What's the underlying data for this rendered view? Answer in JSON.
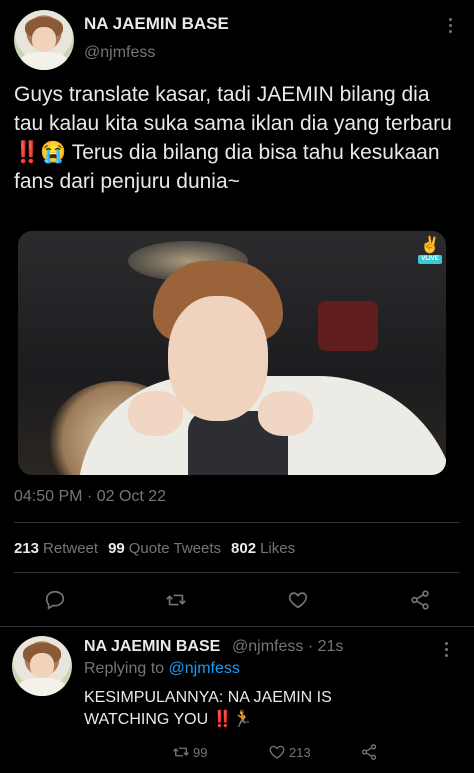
{
  "tweet": {
    "author_name": "NA JAEMIN BASE",
    "author_handle": "@njmfess",
    "text": "Guys translate kasar, tadi JAEMIN bilang dia tau kalau kita suka sama iklan dia yang terbaru ‼️😭 Terus dia bilang dia bisa tahu kesukaan fans dari penjuru dunia~",
    "media_badge": "VLIVE",
    "timestamp": "04:50 PM · 02 Oct 22",
    "stats": {
      "retweets_count": "213",
      "retweets_label": "Retweet",
      "quotes_count": "99",
      "quotes_label": "Quote Tweets",
      "likes_count": "802",
      "likes_label": "Likes"
    }
  },
  "icons": {
    "reply": "reply-icon",
    "retweet": "retweet-icon",
    "like": "heart-icon",
    "share": "share-icon",
    "more": "more-vertical-icon"
  },
  "reply_tweet": {
    "author_name": "NA JAEMIN BASE",
    "handle_time": "@njmfess · 21s",
    "replying_prefix": "Replying to ",
    "replying_mention": "@njmfess",
    "text": "KESIMPULANNYA: NA JAEMIN IS WATCHING YOU ‼️🏃",
    "retweet_count": "99",
    "like_count": "213"
  },
  "colors": {
    "background": "#000000",
    "text": "#e7e9ea",
    "muted": "#71767b",
    "link": "#1d9bf0",
    "divider": "#2f3336",
    "vlive": "#38c9d5"
  }
}
